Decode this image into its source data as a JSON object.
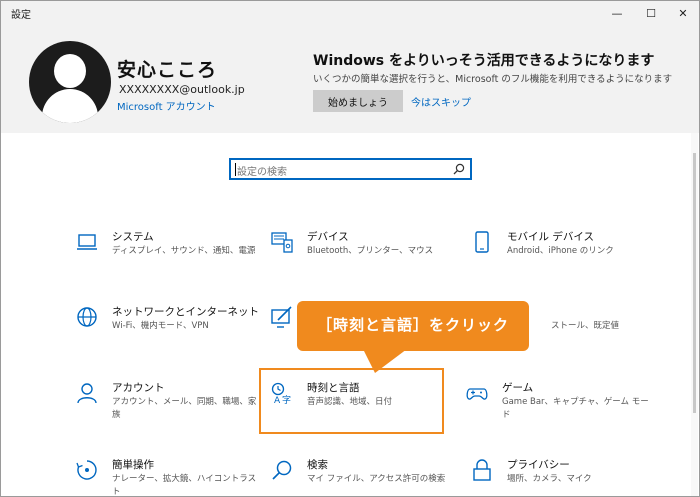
{
  "window": {
    "title": "設定",
    "minimize": "—",
    "maximize": "☐",
    "close": "✕"
  },
  "header": {
    "user_name": "安心こころ",
    "user_email": "XXXXXXXX@outlook.jp",
    "account_link": "Microsoft アカウント",
    "promo_title": "Windows をよりいっそう活用できるようになります",
    "promo_desc": "いくつかの簡単な選択を行うと、Microsoft のフル機能を利用できるようになります",
    "start_button": "始めましょう",
    "skip_link": "今はスキップ"
  },
  "search": {
    "placeholder": "設定の検索"
  },
  "tiles": [
    {
      "name": "システム",
      "desc": "ディスプレイ、サウンド、通知、電源",
      "icon": "laptop-icon"
    },
    {
      "name": "デバイス",
      "desc": "Bluetooth、プリンター、マウス",
      "icon": "devices-icon"
    },
    {
      "name": "モバイル デバイス",
      "desc": "Android、iPhone のリンク",
      "icon": "phone-icon"
    },
    {
      "name": "ネットワークとインターネット",
      "desc": "Wi-Fi、機内モード、VPN",
      "icon": "globe-icon"
    },
    {
      "name": "",
      "desc": "",
      "icon": "personalization-icon"
    },
    {
      "name": "",
      "desc": "ストール、既定値",
      "icon": "apps-icon"
    },
    {
      "name": "アカウント",
      "desc": "アカウント、メール、同期、職場、家族",
      "icon": "person-icon"
    },
    {
      "name": "時刻と言語",
      "desc": "音声認識、地域、日付",
      "icon": "time-language-icon"
    },
    {
      "name": "ゲーム",
      "desc": "Game Bar、キャプチャ、ゲーム モード",
      "icon": "gamepad-icon"
    },
    {
      "name": "簡単操作",
      "desc": "ナレーター、拡大鏡、ハイコントラスト",
      "icon": "ease-of-access-icon"
    },
    {
      "name": "検索",
      "desc": "マイ ファイル、アクセス許可の検索",
      "icon": "search-icon"
    },
    {
      "name": "プライバシー",
      "desc": "場所、カメラ、マイク",
      "icon": "lock-icon"
    }
  ],
  "callout": {
    "text": "［時刻と言語］をクリック"
  },
  "colors": {
    "accent": "#0067c0",
    "highlight": "#f08a1e"
  }
}
